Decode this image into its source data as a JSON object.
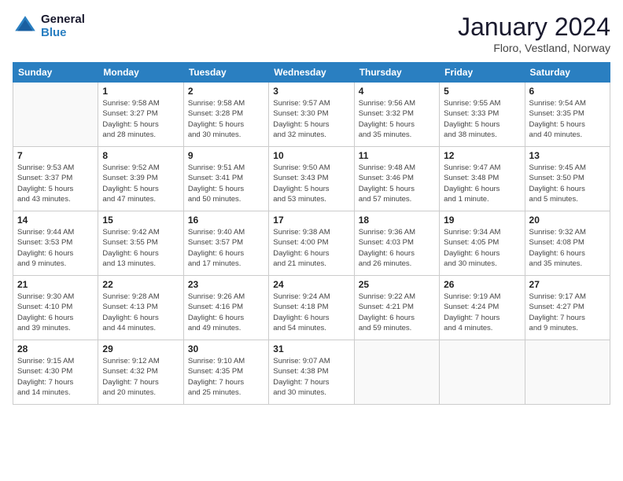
{
  "logo": {
    "line1": "General",
    "line2": "Blue"
  },
  "title": "January 2024",
  "location": "Floro, Vestland, Norway",
  "weekdays": [
    "Sunday",
    "Monday",
    "Tuesday",
    "Wednesday",
    "Thursday",
    "Friday",
    "Saturday"
  ],
  "weeks": [
    [
      {
        "day": "",
        "sunrise": "",
        "sunset": "",
        "daylight": ""
      },
      {
        "day": "1",
        "sunrise": "Sunrise: 9:58 AM",
        "sunset": "Sunset: 3:27 PM",
        "daylight": "Daylight: 5 hours and 28 minutes."
      },
      {
        "day": "2",
        "sunrise": "Sunrise: 9:58 AM",
        "sunset": "Sunset: 3:28 PM",
        "daylight": "Daylight: 5 hours and 30 minutes."
      },
      {
        "day": "3",
        "sunrise": "Sunrise: 9:57 AM",
        "sunset": "Sunset: 3:30 PM",
        "daylight": "Daylight: 5 hours and 32 minutes."
      },
      {
        "day": "4",
        "sunrise": "Sunrise: 9:56 AM",
        "sunset": "Sunset: 3:32 PM",
        "daylight": "Daylight: 5 hours and 35 minutes."
      },
      {
        "day": "5",
        "sunrise": "Sunrise: 9:55 AM",
        "sunset": "Sunset: 3:33 PM",
        "daylight": "Daylight: 5 hours and 38 minutes."
      },
      {
        "day": "6",
        "sunrise": "Sunrise: 9:54 AM",
        "sunset": "Sunset: 3:35 PM",
        "daylight": "Daylight: 5 hours and 40 minutes."
      }
    ],
    [
      {
        "day": "7",
        "sunrise": "Sunrise: 9:53 AM",
        "sunset": "Sunset: 3:37 PM",
        "daylight": "Daylight: 5 hours and 43 minutes."
      },
      {
        "day": "8",
        "sunrise": "Sunrise: 9:52 AM",
        "sunset": "Sunset: 3:39 PM",
        "daylight": "Daylight: 5 hours and 47 minutes."
      },
      {
        "day": "9",
        "sunrise": "Sunrise: 9:51 AM",
        "sunset": "Sunset: 3:41 PM",
        "daylight": "Daylight: 5 hours and 50 minutes."
      },
      {
        "day": "10",
        "sunrise": "Sunrise: 9:50 AM",
        "sunset": "Sunset: 3:43 PM",
        "daylight": "Daylight: 5 hours and 53 minutes."
      },
      {
        "day": "11",
        "sunrise": "Sunrise: 9:48 AM",
        "sunset": "Sunset: 3:46 PM",
        "daylight": "Daylight: 5 hours and 57 minutes."
      },
      {
        "day": "12",
        "sunrise": "Sunrise: 9:47 AM",
        "sunset": "Sunset: 3:48 PM",
        "daylight": "Daylight: 6 hours and 1 minute."
      },
      {
        "day": "13",
        "sunrise": "Sunrise: 9:45 AM",
        "sunset": "Sunset: 3:50 PM",
        "daylight": "Daylight: 6 hours and 5 minutes."
      }
    ],
    [
      {
        "day": "14",
        "sunrise": "Sunrise: 9:44 AM",
        "sunset": "Sunset: 3:53 PM",
        "daylight": "Daylight: 6 hours and 9 minutes."
      },
      {
        "day": "15",
        "sunrise": "Sunrise: 9:42 AM",
        "sunset": "Sunset: 3:55 PM",
        "daylight": "Daylight: 6 hours and 13 minutes."
      },
      {
        "day": "16",
        "sunrise": "Sunrise: 9:40 AM",
        "sunset": "Sunset: 3:57 PM",
        "daylight": "Daylight: 6 hours and 17 minutes."
      },
      {
        "day": "17",
        "sunrise": "Sunrise: 9:38 AM",
        "sunset": "Sunset: 4:00 PM",
        "daylight": "Daylight: 6 hours and 21 minutes."
      },
      {
        "day": "18",
        "sunrise": "Sunrise: 9:36 AM",
        "sunset": "Sunset: 4:03 PM",
        "daylight": "Daylight: 6 hours and 26 minutes."
      },
      {
        "day": "19",
        "sunrise": "Sunrise: 9:34 AM",
        "sunset": "Sunset: 4:05 PM",
        "daylight": "Daylight: 6 hours and 30 minutes."
      },
      {
        "day": "20",
        "sunrise": "Sunrise: 9:32 AM",
        "sunset": "Sunset: 4:08 PM",
        "daylight": "Daylight: 6 hours and 35 minutes."
      }
    ],
    [
      {
        "day": "21",
        "sunrise": "Sunrise: 9:30 AM",
        "sunset": "Sunset: 4:10 PM",
        "daylight": "Daylight: 6 hours and 39 minutes."
      },
      {
        "day": "22",
        "sunrise": "Sunrise: 9:28 AM",
        "sunset": "Sunset: 4:13 PM",
        "daylight": "Daylight: 6 hours and 44 minutes."
      },
      {
        "day": "23",
        "sunrise": "Sunrise: 9:26 AM",
        "sunset": "Sunset: 4:16 PM",
        "daylight": "Daylight: 6 hours and 49 minutes."
      },
      {
        "day": "24",
        "sunrise": "Sunrise: 9:24 AM",
        "sunset": "Sunset: 4:18 PM",
        "daylight": "Daylight: 6 hours and 54 minutes."
      },
      {
        "day": "25",
        "sunrise": "Sunrise: 9:22 AM",
        "sunset": "Sunset: 4:21 PM",
        "daylight": "Daylight: 6 hours and 59 minutes."
      },
      {
        "day": "26",
        "sunrise": "Sunrise: 9:19 AM",
        "sunset": "Sunset: 4:24 PM",
        "daylight": "Daylight: 7 hours and 4 minutes."
      },
      {
        "day": "27",
        "sunrise": "Sunrise: 9:17 AM",
        "sunset": "Sunset: 4:27 PM",
        "daylight": "Daylight: 7 hours and 9 minutes."
      }
    ],
    [
      {
        "day": "28",
        "sunrise": "Sunrise: 9:15 AM",
        "sunset": "Sunset: 4:30 PM",
        "daylight": "Daylight: 7 hours and 14 minutes."
      },
      {
        "day": "29",
        "sunrise": "Sunrise: 9:12 AM",
        "sunset": "Sunset: 4:32 PM",
        "daylight": "Daylight: 7 hours and 20 minutes."
      },
      {
        "day": "30",
        "sunrise": "Sunrise: 9:10 AM",
        "sunset": "Sunset: 4:35 PM",
        "daylight": "Daylight: 7 hours and 25 minutes."
      },
      {
        "day": "31",
        "sunrise": "Sunrise: 9:07 AM",
        "sunset": "Sunset: 4:38 PM",
        "daylight": "Daylight: 7 hours and 30 minutes."
      },
      {
        "day": "",
        "sunrise": "",
        "sunset": "",
        "daylight": ""
      },
      {
        "day": "",
        "sunrise": "",
        "sunset": "",
        "daylight": ""
      },
      {
        "day": "",
        "sunrise": "",
        "sunset": "",
        "daylight": ""
      }
    ]
  ]
}
